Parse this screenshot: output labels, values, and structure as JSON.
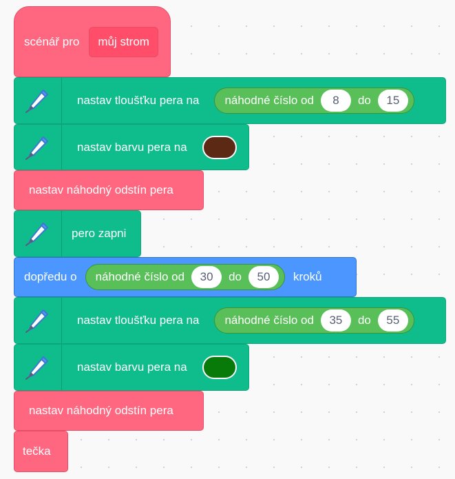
{
  "colors": {
    "more_blocks": "#ff6680",
    "pen": "#0fbd8c",
    "motion": "#4c97ff",
    "operators": "#59c059",
    "pen_color_1": "#5c2a14",
    "pen_color_2": "#077a0a"
  },
  "blocks": [
    {
      "id": "define",
      "label": "scénář pro",
      "argument": "můj strom"
    },
    {
      "id": "set_size_1",
      "icon": "pen-icon",
      "label": "nastav tloušťku pera na",
      "operator": "náhodné číslo od",
      "from": "8",
      "to_label": "do",
      "to": "15"
    },
    {
      "id": "set_color_1",
      "icon": "pen-icon",
      "label": "nastav barvu pera na",
      "color": "#5c2a14"
    },
    {
      "id": "random_hue_1",
      "label": "nastav náhodný odstín pera"
    },
    {
      "id": "pen_down",
      "icon": "pen-icon",
      "label": "pero zapni"
    },
    {
      "id": "move",
      "label": "dopředu o",
      "operator": "náhodné číslo od",
      "from": "30",
      "to_label": "do",
      "to": "50",
      "suffix": "kroků"
    },
    {
      "id": "set_size_2",
      "icon": "pen-icon",
      "label": "nastav tloušťku pera na",
      "operator": "náhodné číslo od",
      "from": "35",
      "to_label": "do",
      "to": "55"
    },
    {
      "id": "set_color_2",
      "icon": "pen-icon",
      "label": "nastav barvu pera na",
      "color": "#077a0a"
    },
    {
      "id": "random_hue_2",
      "label": "nastav náhodný odstín pera"
    },
    {
      "id": "dot",
      "label": "tečka"
    }
  ]
}
